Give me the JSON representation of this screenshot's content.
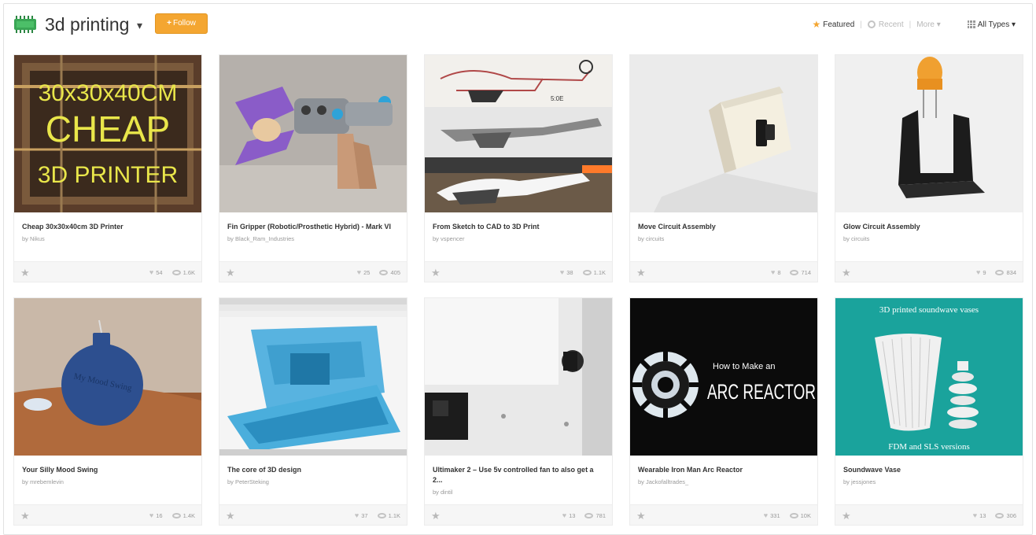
{
  "header": {
    "title": "3d printing",
    "caret": "▾",
    "follow_label": "Follow",
    "follow_plus": "+",
    "icon": "circuit-board-icon"
  },
  "filters": {
    "featured": "Featured",
    "recent": "Recent",
    "more": "More ▾",
    "types": "All Types ▾",
    "separator": "|"
  },
  "colors": {
    "accent": "#f4a631"
  },
  "cards": [
    {
      "title": "Cheap 30x30x40cm 3D Printer",
      "by": "by Nikus",
      "likes": "54",
      "views": "1.6K"
    },
    {
      "title": "Fin Gripper (Robotic/Prosthetic Hybrid) - Mark VI",
      "by": "by Black_Ram_Industries",
      "likes": "25",
      "views": "405"
    },
    {
      "title": "From Sketch to CAD to 3D Print",
      "by": "by vspencer",
      "likes": "38",
      "views": "1.1K"
    },
    {
      "title": "Move Circuit Assembly",
      "by": "by circuits",
      "likes": "8",
      "views": "714"
    },
    {
      "title": "Glow Circuit Assembly",
      "by": "by circuits",
      "likes": "9",
      "views": "834"
    },
    {
      "title": "Your Silly Mood Swing",
      "by": "by mrebemlevin",
      "likes": "16",
      "views": "1.4K"
    },
    {
      "title": "The core of 3D design",
      "by": "by PeterSteking",
      "likes": "37",
      "views": "1.1K"
    },
    {
      "title": "Ultimaker 2 – Use 5v controlled fan to also get a 2...",
      "by": "by dintil",
      "likes": "13",
      "views": "781"
    },
    {
      "title": "Wearable Iron Man Arc Reactor",
      "by": "by Jackofalltrades_",
      "likes": "331",
      "views": "10K"
    },
    {
      "title": "Soundwave Vase",
      "by": "by jessjones",
      "likes": "13",
      "views": "306"
    }
  ],
  "thumb_text": {
    "printer_line1": "30x30x40CM",
    "printer_line2": "CHEAP",
    "printer_line3": "3D PRINTER",
    "sketch_note": "5:0E",
    "mood": "My Mood Swing",
    "arc_small": "How to Make an",
    "arc_big": "ARC REACTOR",
    "vase_top": "3D printed soundwave vases",
    "vase_bottom": "FDM and SLS versions"
  },
  "icons": {
    "star": "★",
    "heart": "♥"
  }
}
